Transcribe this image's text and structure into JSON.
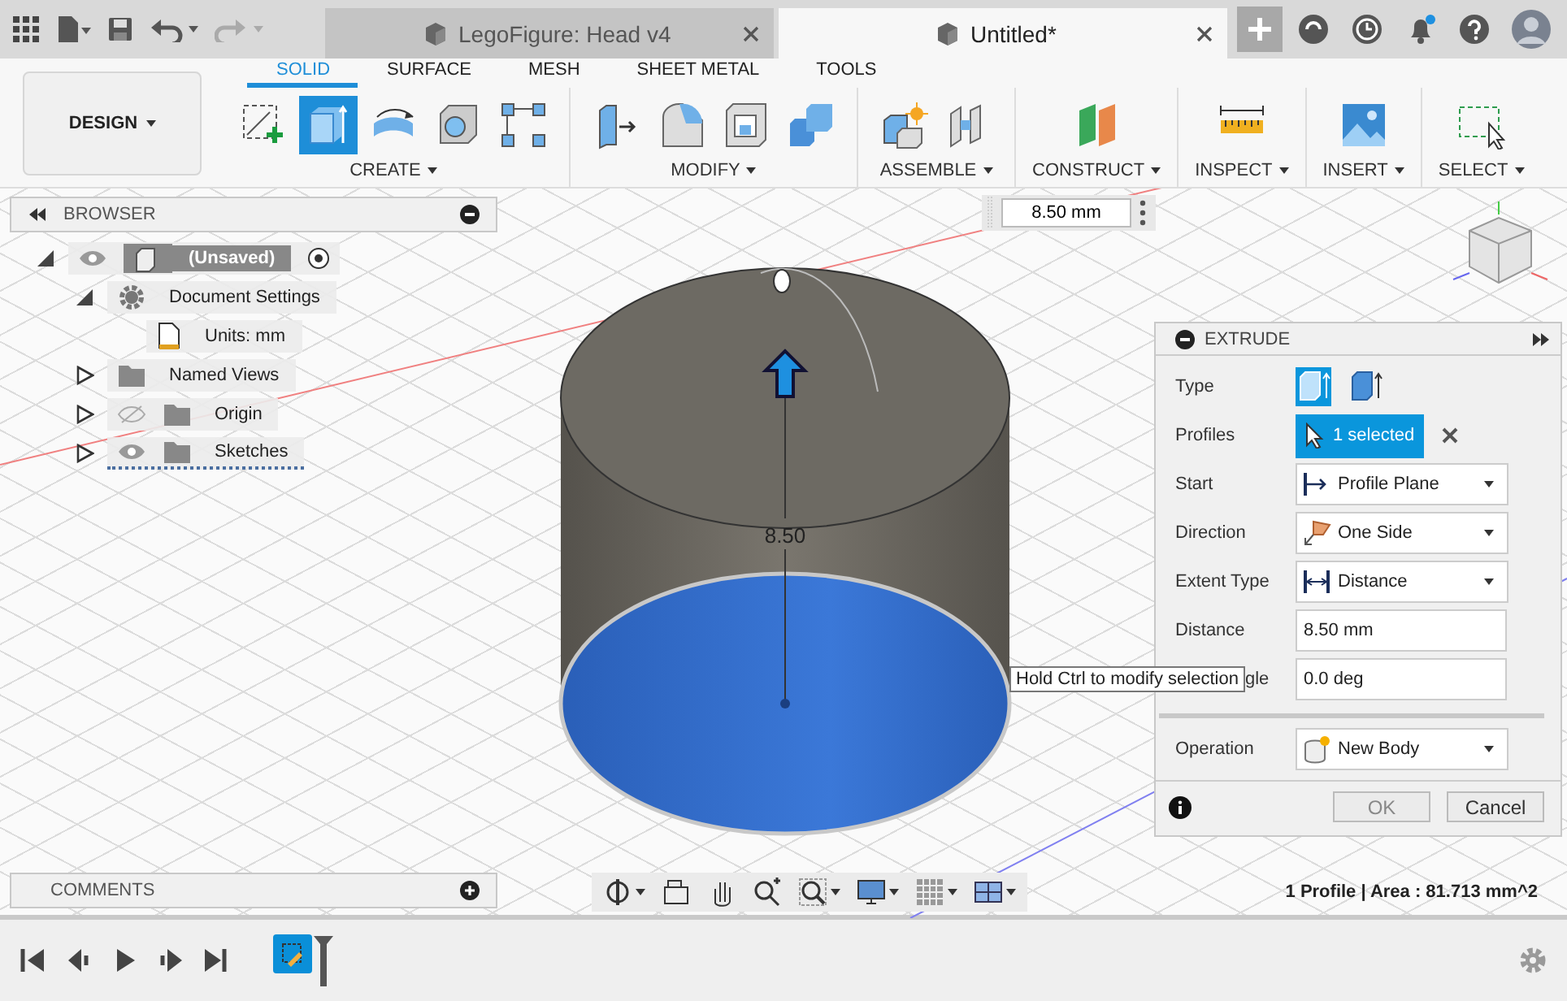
{
  "document_tabs": [
    {
      "label": "LegoFigure: Head v4",
      "selected": false
    },
    {
      "label": "Untitled*",
      "selected": true
    }
  ],
  "workspace": {
    "label": "DESIGN"
  },
  "ribbon_tabs": [
    {
      "label": "SOLID",
      "selected": true
    },
    {
      "label": "SURFACE",
      "selected": false
    },
    {
      "label": "MESH",
      "selected": false
    },
    {
      "label": "SHEET METAL",
      "selected": false
    },
    {
      "label": "TOOLS",
      "selected": false
    }
  ],
  "ribbon_groups": [
    {
      "label": "CREATE",
      "tools": [
        {
          "selected": false
        },
        {
          "selected": true
        },
        {
          "selected": false
        },
        {
          "selected": false
        },
        {
          "selected": false
        }
      ]
    },
    {
      "label": "MODIFY",
      "tools": [
        {
          "selected": false
        },
        {
          "selected": false
        },
        {
          "selected": false
        },
        {
          "selected": false
        }
      ]
    },
    {
      "label": "ASSEMBLE",
      "tools": [
        {
          "selected": false
        },
        {
          "selected": false
        }
      ]
    },
    {
      "label": "CONSTRUCT",
      "tools": [
        {
          "selected": false
        }
      ]
    },
    {
      "label": "INSPECT",
      "tools": [
        {
          "selected": false
        }
      ]
    },
    {
      "label": "INSERT",
      "tools": [
        {
          "selected": false
        }
      ]
    },
    {
      "label": "SELECT",
      "tools": [
        {
          "selected": false
        }
      ]
    }
  ],
  "browser": {
    "title": "BROWSER",
    "tree": [
      {
        "label": "(Unsaved)",
        "kind": "component",
        "selected": true,
        "expanded": true,
        "visible": true,
        "children": [
          {
            "label": "Document Settings",
            "kind": "settings",
            "selected": false,
            "expanded": true,
            "children": [
              {
                "label": "Units: mm",
                "kind": "units",
                "selected": false
              }
            ]
          },
          {
            "label": "Named Views",
            "kind": "folder",
            "selected": false,
            "expanded": false
          },
          {
            "label": "Origin",
            "kind": "folder",
            "selected": false,
            "expanded": false,
            "visible": false
          },
          {
            "label": "Sketches",
            "kind": "sketches",
            "selected": false,
            "expanded": false,
            "visible": true
          }
        ]
      }
    ]
  },
  "dimension_field": {
    "value": "8.50 mm"
  },
  "dimension_label": "8.50",
  "tooltip": "Hold Ctrl to modify selection",
  "extrude": {
    "title": "EXTRUDE",
    "rows": [
      {
        "kind": "icons",
        "label": "Type",
        "options": [
          {
            "selected": true
          },
          {
            "selected": false
          }
        ]
      },
      {
        "kind": "selection",
        "label": "Profiles",
        "value": "1 selected"
      },
      {
        "kind": "dropdown",
        "label": "Start",
        "value": "Profile Plane"
      },
      {
        "kind": "dropdown",
        "label": "Direction",
        "value": "One Side"
      },
      {
        "kind": "dropdown",
        "label": "Extent Type",
        "value": "Distance"
      },
      {
        "kind": "input",
        "label": "Distance",
        "value": "8.50 mm"
      },
      {
        "kind": "input",
        "label": "gle",
        "value": "0.0 deg"
      },
      {
        "kind": "separator"
      },
      {
        "kind": "dropdown",
        "label": "Operation",
        "value": "New Body"
      }
    ],
    "buttons": [
      {
        "label": "OK",
        "disabled": true
      },
      {
        "label": "Cancel",
        "disabled": false
      }
    ]
  },
  "comments": {
    "title": "COMMENTS"
  },
  "status": "1 Profile | Area : 81.713 mm^2"
}
